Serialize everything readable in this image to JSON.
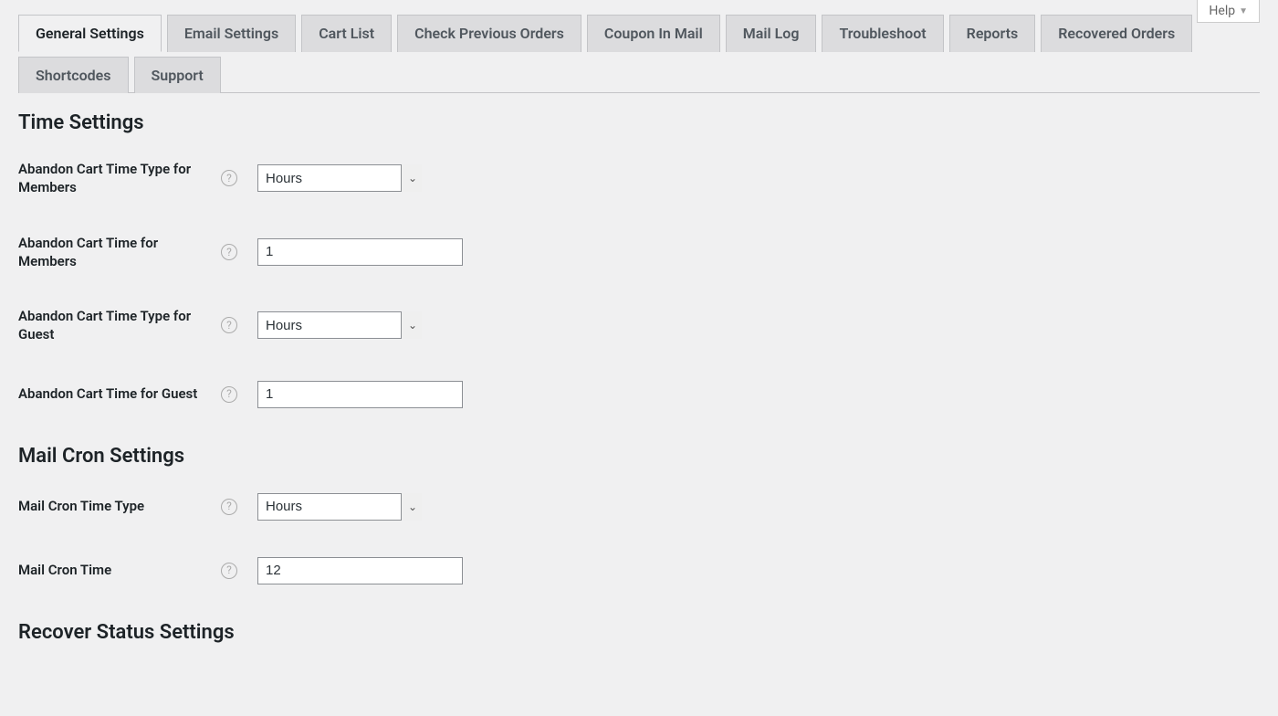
{
  "help_tab": "Help",
  "tabs": [
    {
      "label": "General Settings",
      "active": true
    },
    {
      "label": "Email Settings",
      "active": false
    },
    {
      "label": "Cart List",
      "active": false
    },
    {
      "label": "Check Previous Orders",
      "active": false
    },
    {
      "label": "Coupon In Mail",
      "active": false
    },
    {
      "label": "Mail Log",
      "active": false
    },
    {
      "label": "Troubleshoot",
      "active": false
    },
    {
      "label": "Reports",
      "active": false
    },
    {
      "label": "Recovered Orders",
      "active": false
    },
    {
      "label": "Shortcodes",
      "active": false
    },
    {
      "label": "Support",
      "active": false
    }
  ],
  "sections": {
    "time": {
      "title": "Time Settings",
      "fields": {
        "member_type": {
          "label": "Abandon Cart Time Type for Members",
          "value": "Hours"
        },
        "member_time": {
          "label": "Abandon Cart Time for Members",
          "value": "1"
        },
        "guest_type": {
          "label": "Abandon Cart Time Type for Guest",
          "value": "Hours"
        },
        "guest_time": {
          "label": "Abandon Cart Time for Guest",
          "value": "1"
        }
      }
    },
    "mailcron": {
      "title": "Mail Cron Settings",
      "fields": {
        "cron_type": {
          "label": "Mail Cron Time Type",
          "value": "Hours"
        },
        "cron_time": {
          "label": "Mail Cron Time",
          "value": "12"
        }
      }
    },
    "recover": {
      "title": "Recover Status Settings"
    }
  },
  "select_options": [
    "Hours"
  ]
}
